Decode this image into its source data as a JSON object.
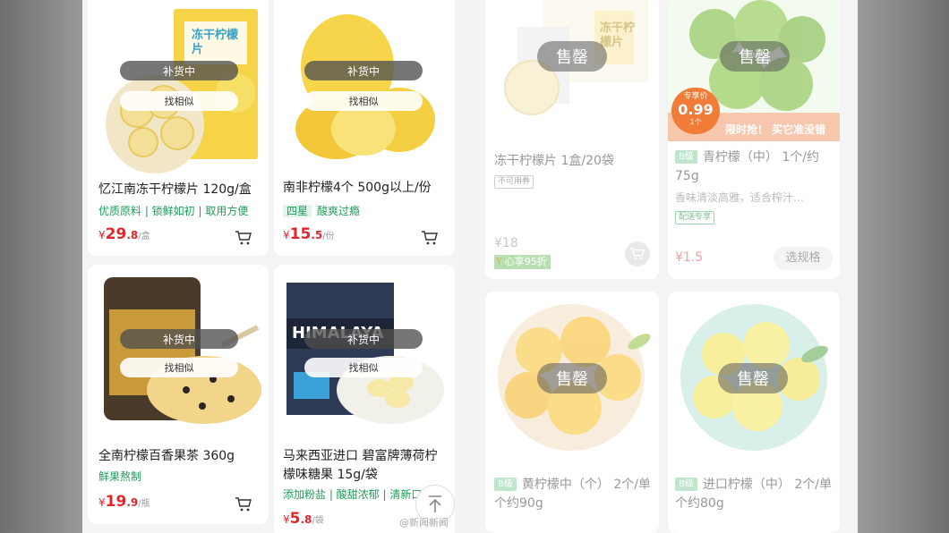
{
  "colors": {
    "accent_red": "#e4262a",
    "accent_green": "#1e9e58",
    "sold_grey": "#999999"
  },
  "left_products": [
    {
      "title": "忆江南冻干柠檬片 120g/盒",
      "subtitle": "优质原料 | 锁鲜如初 | 取用方便",
      "price_currency": "¥",
      "price_int": "29",
      "price_dec": ".8",
      "price_unit": "/盒",
      "status": "补货中",
      "similar": "找相似",
      "package_text": "冻干柠檬片"
    },
    {
      "title": "南非柠檬4个 500g以上/份",
      "subtitle_badge": "四星",
      "subtitle": "酸爽过瘾",
      "price_currency": "¥",
      "price_int": "15",
      "price_dec": ".5",
      "price_unit": "/份",
      "status": "补货中",
      "similar": "找相似"
    },
    {
      "title": "全南柠檬百香果茶 360g",
      "subtitle": "鲜果熬制",
      "price_currency": "¥",
      "price_int": "19",
      "price_dec": ".9",
      "price_unit": "/瓶",
      "status": "补货中",
      "similar": "找相似"
    },
    {
      "title": "马来西亚进口 碧富牌薄荷柠檬味糖果 15g/袋",
      "subtitle": "添加粉盐 | 酸甜浓郁 | 清新口",
      "price_currency": "¥",
      "price_int": "5",
      "price_dec": ".8",
      "price_unit": "/袋",
      "status": "补货中",
      "similar": "找相似",
      "package_text": "HIMALAYA"
    }
  ],
  "right_products": [
    {
      "title": "冻干柠檬片 1盒/20袋",
      "tag": "不可用券",
      "price": "¥18",
      "member_label": "心享95折",
      "status": "售罄",
      "package_text": "冻干柠檬片"
    },
    {
      "grade": "B级",
      "title": "青柠檬（中） 1个/约75g",
      "desc": "香味清淡高雅，适合榨汁…",
      "tag": "配送专享",
      "price": "¥1.5",
      "option_button": "选规格",
      "status": "售罄",
      "promo_label": "专享价",
      "promo_price": "0.99",
      "promo_unit": "1个",
      "promo_banner": "限时抢！ 买它准没错"
    },
    {
      "grade": "B级",
      "title": "黄柠檬中（个） 2个/单个约90g",
      "status": "售罄"
    },
    {
      "grade": "B级",
      "title": "进口柠檬（中） 2个/单个约80g",
      "status": "售罄"
    }
  ],
  "overlay": {
    "watermark": "@新闻新闻"
  }
}
